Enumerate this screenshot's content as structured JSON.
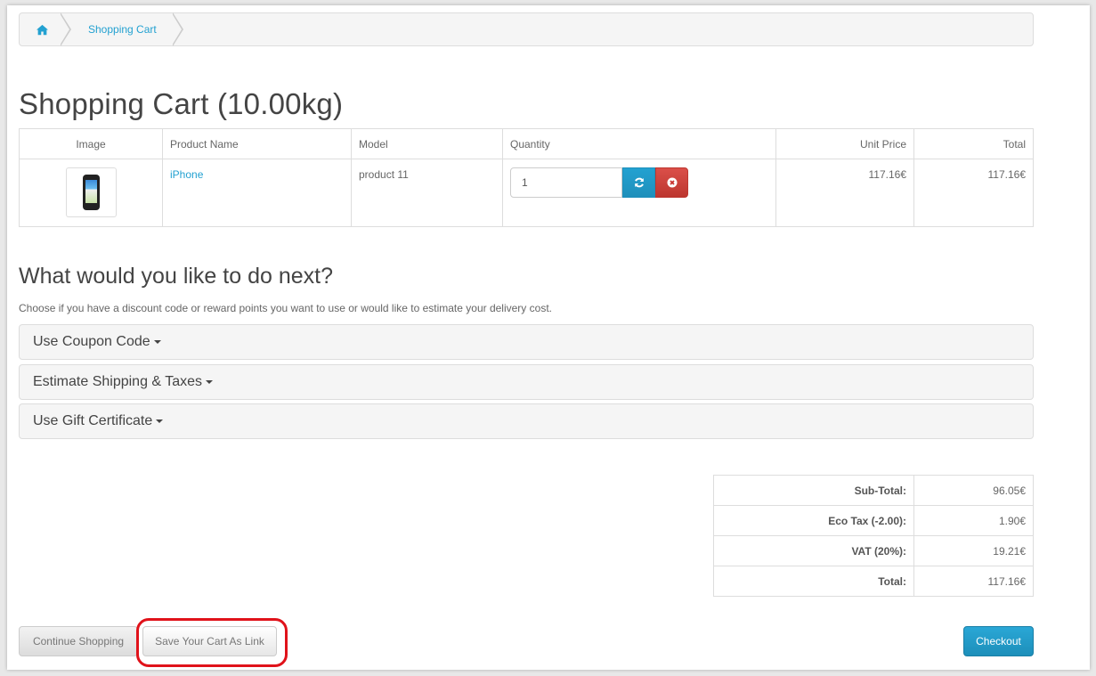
{
  "breadcrumb": {
    "home_icon": "home-icon",
    "current": "Shopping Cart"
  },
  "page": {
    "title": "Shopping Cart  (10.00kg)",
    "next_heading": "What would you like to do next?",
    "next_intro": "Choose if you have a discount code or reward points you want to use or would like to estimate your delivery cost."
  },
  "cart_table": {
    "headers": [
      "Image",
      "Product Name",
      "Model",
      "Quantity",
      "Unit Price",
      "Total"
    ],
    "rows": [
      {
        "image_icon": "iphone-thumbnail",
        "name": "iPhone",
        "model": "product 11",
        "quantity": "1",
        "unit_price": "117.16€",
        "total": "117.16€"
      }
    ],
    "refresh_icon": "refresh-icon",
    "remove_icon": "remove-icon"
  },
  "panels": [
    {
      "label": "Use Coupon Code"
    },
    {
      "label": "Estimate Shipping & Taxes"
    },
    {
      "label": "Use Gift Certificate"
    }
  ],
  "totals": [
    {
      "label": "Sub-Total:",
      "value": "96.05€"
    },
    {
      "label": "Eco Tax (-2.00):",
      "value": "1.90€"
    },
    {
      "label": "VAT (20%):",
      "value": "19.21€"
    },
    {
      "label": "Total:",
      "value": "117.16€"
    }
  ],
  "buttons": {
    "continue": "Continue Shopping",
    "save_link": "Save Your Cart As Link",
    "checkout": "Checkout"
  },
  "colors": {
    "link": "#23a1d1",
    "refresh": "#23a1d1",
    "remove": "#da4f49",
    "checkout": "#23a1d1",
    "highlight": "#e0121a"
  }
}
